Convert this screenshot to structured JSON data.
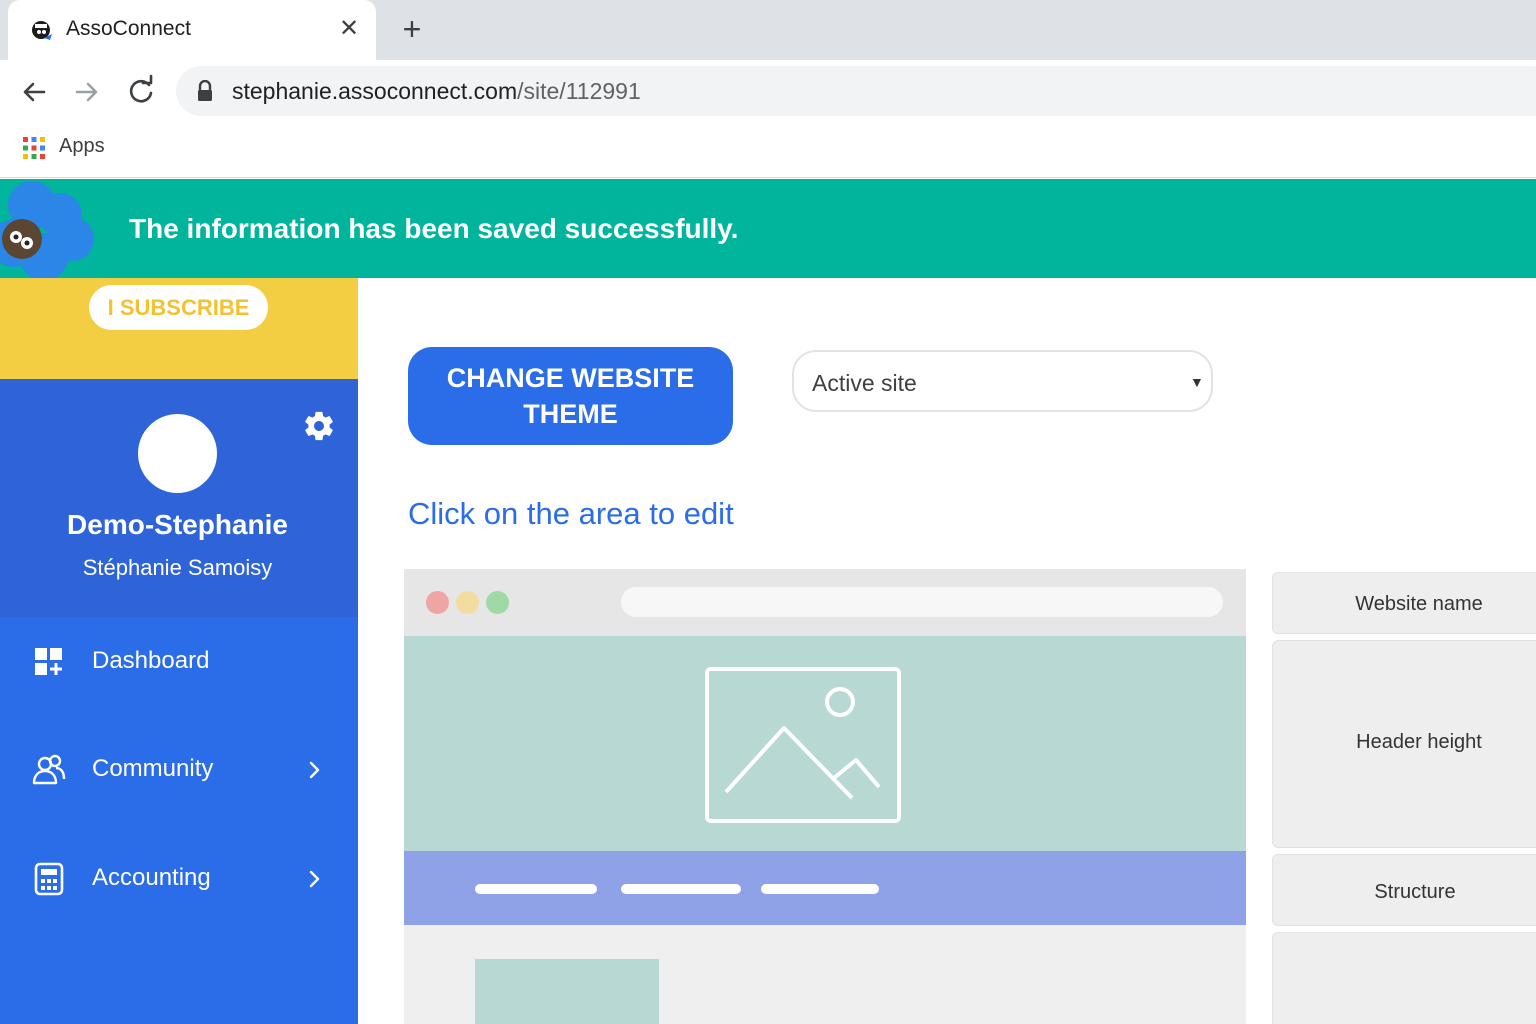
{
  "browser": {
    "tab_title": "AssoConnect",
    "url_host": "stephanie.assoconnect.com",
    "url_path": "/site/112991",
    "bookmarks_apps_label": "Apps"
  },
  "notification": {
    "message": "The information has been saved successfully."
  },
  "sidebar": {
    "subscribe_label": "I SUBSCRIBE",
    "org_name": "Demo-Stephanie",
    "user_name": "Stéphanie Samoisy",
    "items": [
      {
        "label": "Dashboard",
        "icon": "dashboard-icon"
      },
      {
        "label": "Community",
        "icon": "community-icon"
      },
      {
        "label": "Accounting",
        "icon": "calculator-icon"
      }
    ]
  },
  "main": {
    "theme_button_label": "CHANGE WEBSITE THEME",
    "site_select_value": "Active site",
    "edit_hint": "Click on the area to edit"
  },
  "panel": {
    "items": [
      "Website name",
      "Header height",
      "Structure"
    ]
  },
  "colors": {
    "primary_blue": "#2b6ce8",
    "success_green": "#00b59c",
    "subscribe_yellow": "#f3cd42"
  }
}
